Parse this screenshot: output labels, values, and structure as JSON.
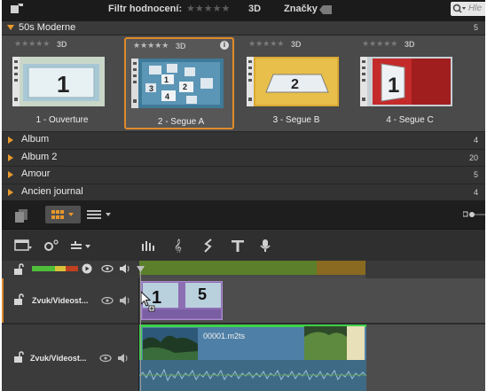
{
  "topbar": {
    "filter_label": "Filtr hodnocení:",
    "filter_stars": "★★★★★",
    "label_3d": "3D",
    "tags_label": "Značky",
    "search_placeholder": "Hle"
  },
  "collection": {
    "name": "50s Moderne",
    "count": "5"
  },
  "thumbnails": [
    {
      "caption": "1 - Ouverture",
      "rating": "★★★★★",
      "label_3d": "3D",
      "number": "1",
      "selected": false
    },
    {
      "caption": "2 - Segue A",
      "rating": "★★★★★",
      "label_3d": "3D",
      "number": "",
      "selected": true
    },
    {
      "caption": "3 - Segue B",
      "rating": "★★★★★",
      "label_3d": "3D",
      "number": "2",
      "selected": false
    },
    {
      "caption": "4 - Segue C",
      "rating": "★★★★★",
      "label_3d": "3D",
      "number": "1",
      "selected": false
    }
  ],
  "thumb2_numbers": [
    "1",
    "2",
    "3",
    "4"
  ],
  "info_glyph": "i",
  "albums": [
    {
      "name": "Album",
      "count": "4"
    },
    {
      "name": "Album 2",
      "count": "20"
    },
    {
      "name": "Amour",
      "count": "5"
    },
    {
      "name": "Ancien journal",
      "count": "4"
    }
  ],
  "tracks": [
    {
      "name": "Zvuk/Videost...",
      "clip_numbers": [
        "1",
        "5"
      ]
    },
    {
      "name": "Zvuk/Videost...",
      "clip_title": "00001.m2ts"
    }
  ],
  "colors": {
    "accent": "#e08a2a",
    "timeline_green": "#5b7f2a",
    "timeline_orange": "#8a6a20",
    "clip_purple": "#8c6fb3",
    "clip_green_border": "#3fd24a"
  }
}
